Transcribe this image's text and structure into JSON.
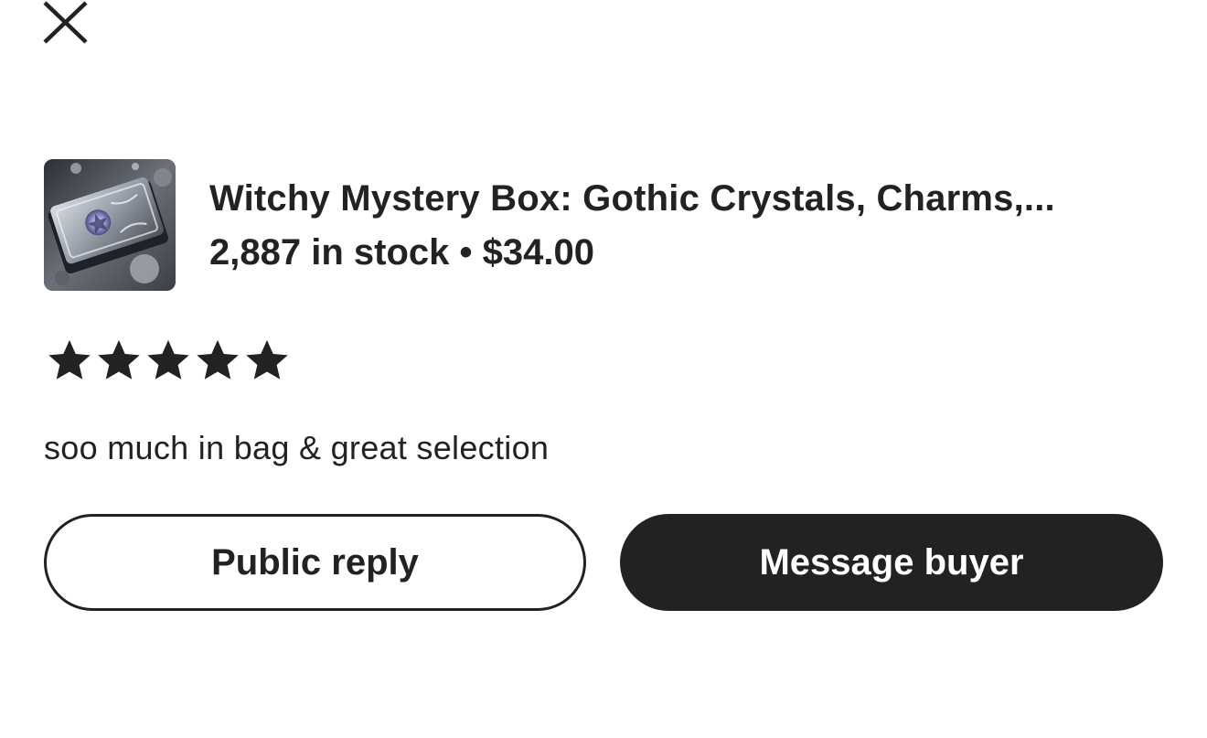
{
  "header": {
    "close_icon": "close-icon"
  },
  "product": {
    "thumbnail_icon": "product-thumbnail",
    "title": "Witchy Mystery Box: Gothic Crystals, Charms,...",
    "meta": "2,887 in stock • $34.00"
  },
  "review": {
    "rating": 5,
    "max_rating": 5,
    "text": "soo much in bag & great selection"
  },
  "actions": {
    "public_reply_label": "Public reply",
    "message_buyer_label": "Message buyer"
  },
  "colors": {
    "text": "#222222",
    "primary_button_bg": "#222222",
    "primary_button_text": "#ffffff",
    "background": "#ffffff"
  }
}
